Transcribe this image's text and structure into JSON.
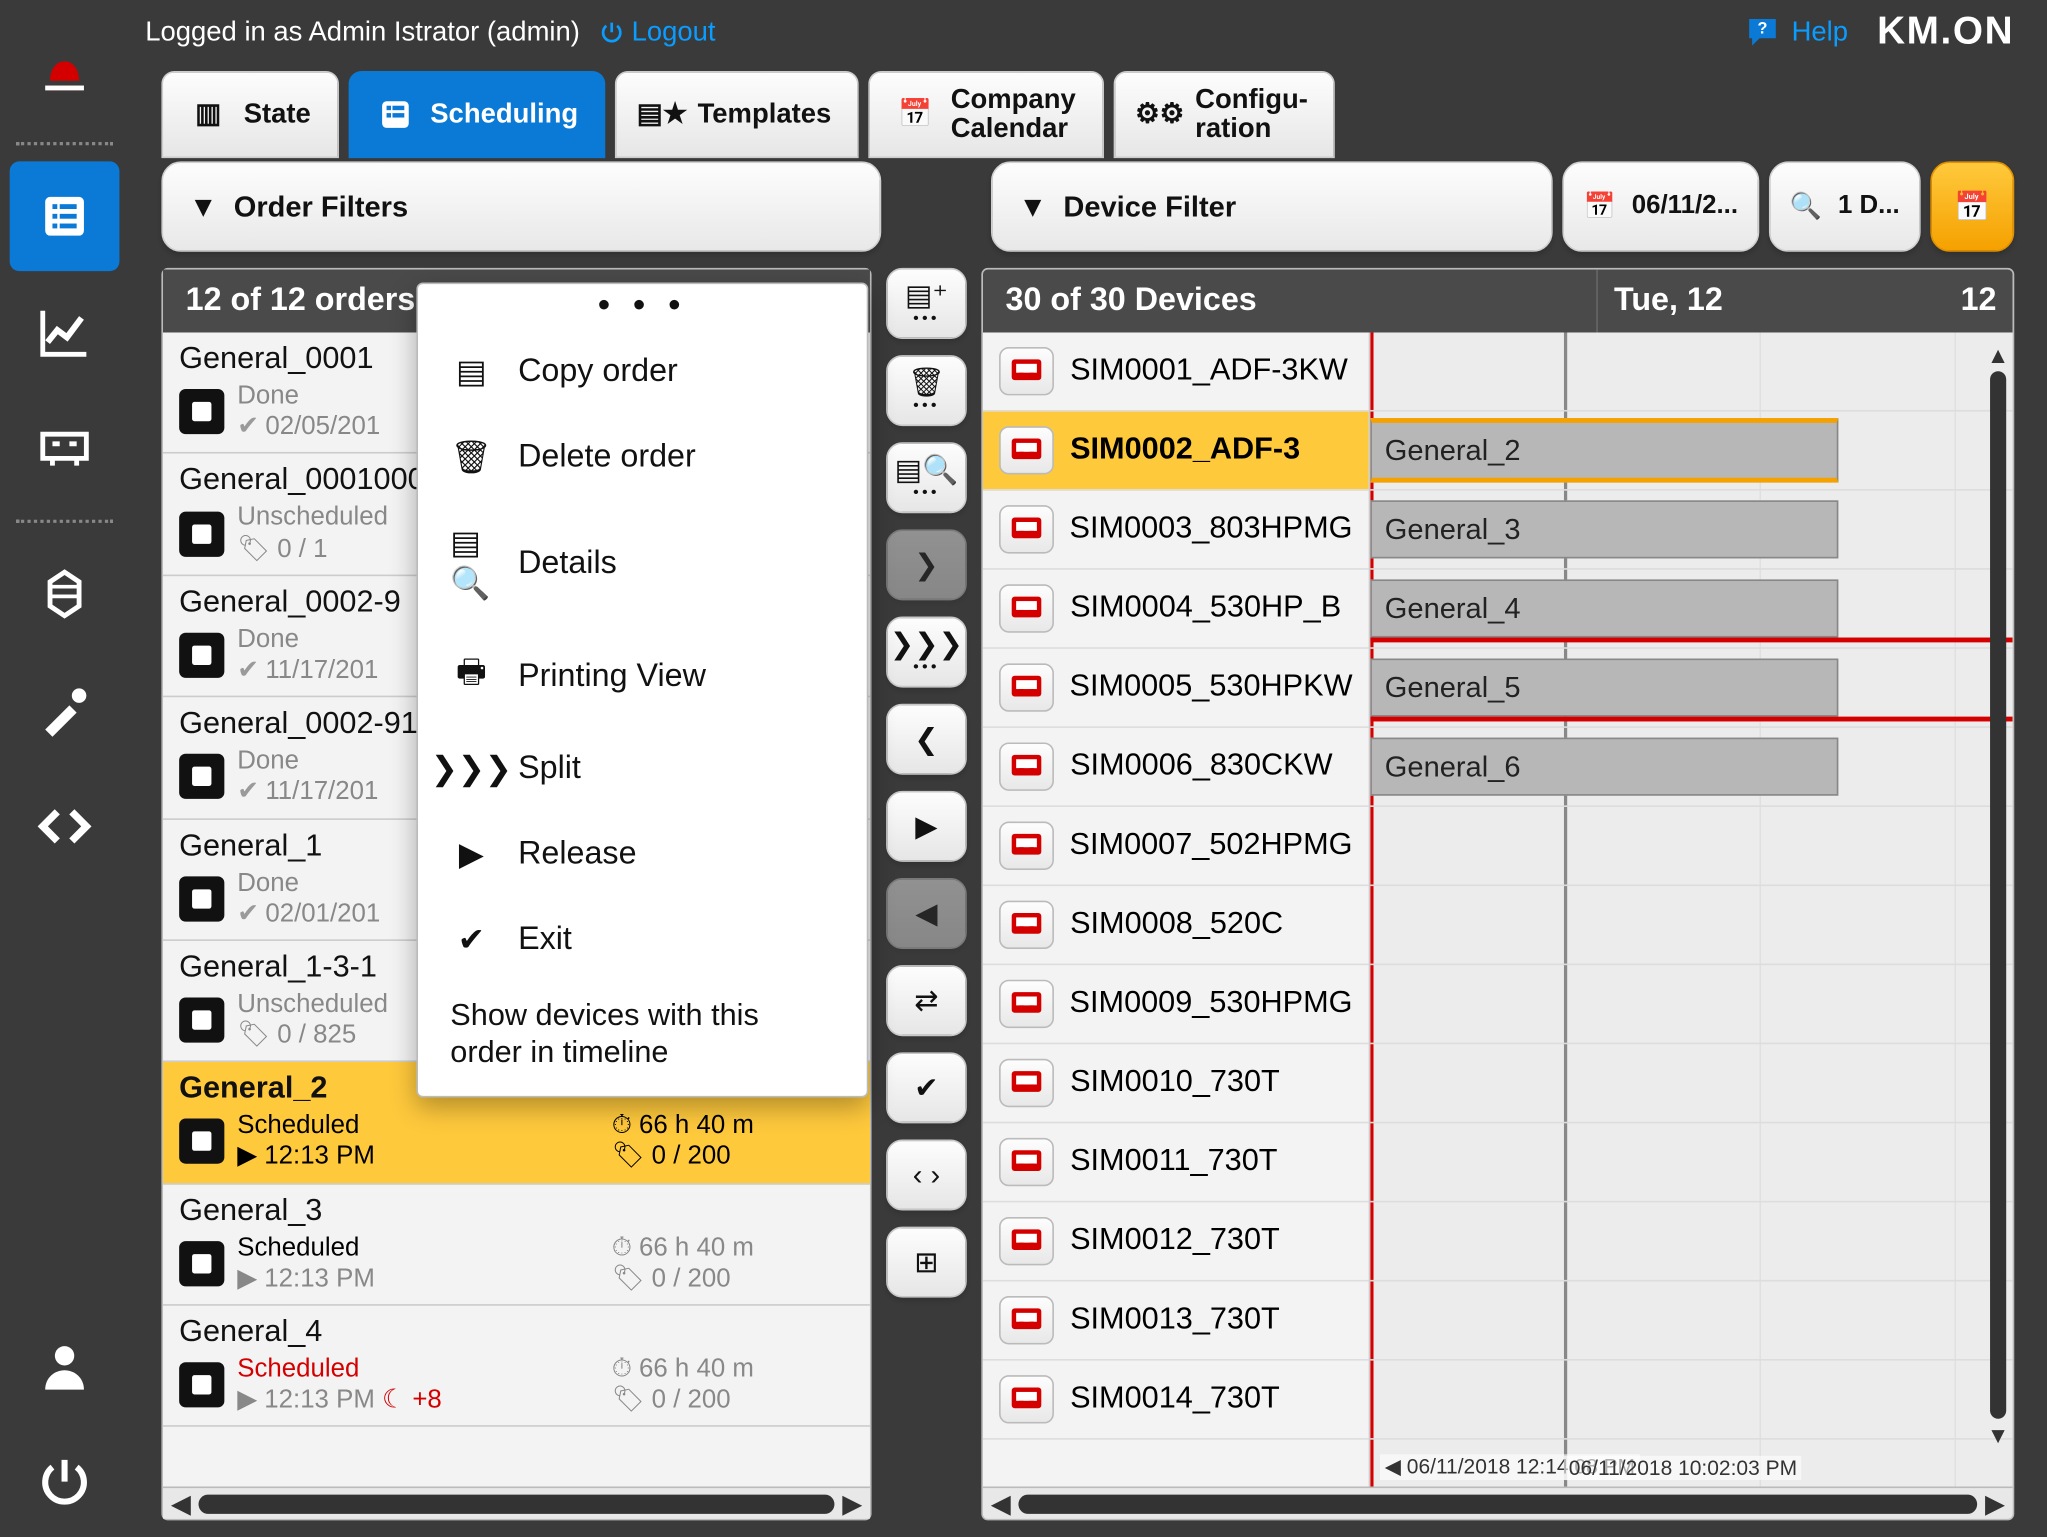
{
  "user_line": "Logged in as Admin Istrator (admin)",
  "logout": "Logout",
  "help": "Help",
  "logo": "KM.ON",
  "tabs": {
    "state": "State",
    "scheduling": "Scheduling",
    "templates": "Templates",
    "calendar_l1": "Company",
    "calendar_l2": "Calendar",
    "config_l1": "Configu-",
    "config_l2": "ration"
  },
  "filters": {
    "order": "Order Filters",
    "device": "Device Filter",
    "date": "06/11/2...",
    "days": "1 D..."
  },
  "orders_header": "12 of 12 orders",
  "devices_header": "30 of 30 Devices",
  "timeline": {
    "day": "Tue, 12",
    "hour": "12",
    "ts1": "06/11/2018 12:14:08 PM",
    "ts2": "06/11/2018 10:02:03 PM"
  },
  "ctx": {
    "copy": "Copy order",
    "delete": "Delete order",
    "details": "Details",
    "print": "Printing View",
    "split": "Split",
    "release": "Release",
    "exit": "Exit",
    "show": "Show devices with this order in timeline"
  },
  "orders": [
    {
      "title": "General_0001",
      "status": "Done",
      "sub": "02/05/201"
    },
    {
      "title": "General_0001000",
      "status": "Unscheduled",
      "sub": "0 / 1"
    },
    {
      "title": "General_0002-9",
      "status": "Done",
      "sub": "11/17/201"
    },
    {
      "title": "General_0002-91",
      "status": "Done",
      "sub": "11/17/201"
    },
    {
      "title": "General_1",
      "status": "Done",
      "sub": "02/01/201"
    },
    {
      "title": "General_1-3-1",
      "status": "Unscheduled",
      "sub": "0 / 825"
    },
    {
      "title": "General_2",
      "status": "Scheduled",
      "sub": "12:13 PM",
      "dur": "66 h 40 m",
      "qty": "0 / 200",
      "sel": true
    },
    {
      "title": "General_3",
      "status": "Scheduled",
      "sub": "12:13 PM",
      "dur": "66 h 40 m",
      "qty": "0 / 200"
    },
    {
      "title": "General_4",
      "status": "Scheduled",
      "sub": "12:13 PM",
      "dur": "66 h 40 m",
      "qty": "0 / 200",
      "late": "+8"
    }
  ],
  "devices": [
    {
      "name": "SIM0001_ADF-3KW"
    },
    {
      "name": "SIM0002_ADF-3",
      "bar": "General_2",
      "sel": true
    },
    {
      "name": "SIM0003_803HPMG",
      "bar": "General_3"
    },
    {
      "name": "SIM0004_530HP_B",
      "bar": "General_4",
      "red": "bottom"
    },
    {
      "name": "SIM0005_530HPKW",
      "bar": "General_5",
      "red": "bottom"
    },
    {
      "name": "SIM0006_830CKW",
      "bar": "General_6"
    },
    {
      "name": "SIM0007_502HPMG"
    },
    {
      "name": "SIM0008_520C"
    },
    {
      "name": "SIM0009_530HPMG"
    },
    {
      "name": "SIM0010_730T"
    },
    {
      "name": "SIM0011_730T"
    },
    {
      "name": "SIM0012_730T"
    },
    {
      "name": "SIM0013_730T"
    },
    {
      "name": "SIM0014_730T"
    }
  ]
}
